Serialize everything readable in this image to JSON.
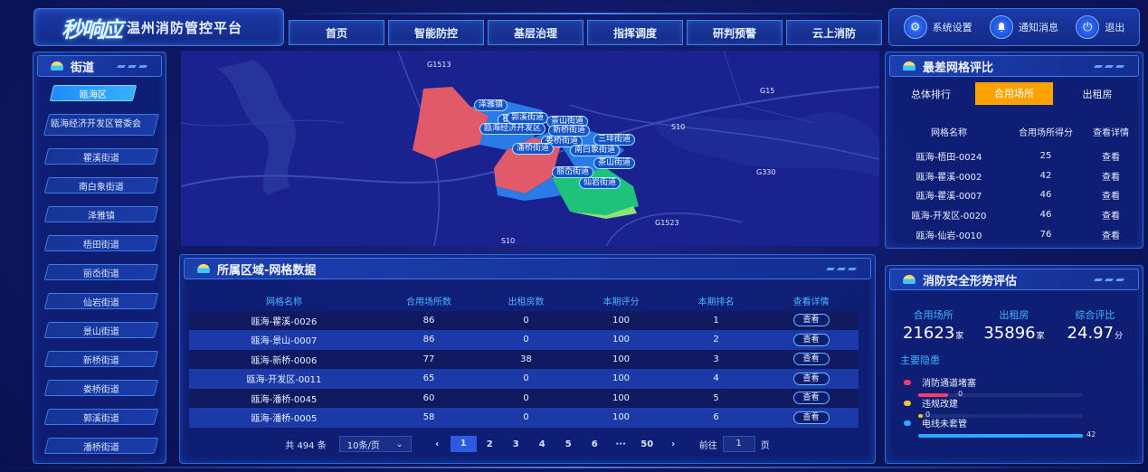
{
  "header": {
    "logo_mark": "秒响应",
    "title": "温州消防管控平台",
    "nav": [
      "首页",
      "智能防控",
      "基层治理",
      "指挥调度",
      "研判预警",
      "云上消防"
    ],
    "system": [
      {
        "label": "系统设置",
        "icon": "gear-icon"
      },
      {
        "label": "通知消息",
        "icon": "bell-icon"
      },
      {
        "label": "退出",
        "icon": "power-icon"
      }
    ]
  },
  "streets": {
    "title": "街道",
    "items": [
      "瓯海区",
      "瓯海经济开发区管委会",
      "瞿溪街道",
      "南白象街道",
      "泽雅镇",
      "梧田街道",
      "丽岙街道",
      "仙岩街道",
      "景山街道",
      "新桥街道",
      "娄桥街道",
      "郭溪街道",
      "潘桥街道"
    ],
    "active_index": 0
  },
  "map": {
    "road_labels": [
      "G1513",
      "G15",
      "S10",
      "G330",
      "G1523",
      "S10"
    ],
    "pins": [
      "泽雅镇",
      "瞿溪街道",
      "郭溪街道",
      "景山街道",
      "瓯海经济开发区",
      "新桥街道",
      "娄桥街道",
      "三垟街道",
      "潘桥街道",
      "南白象街道",
      "茶山街道",
      "丽岙街道",
      "仙岩街道"
    ]
  },
  "grid_data": {
    "title": "所属区域-网格数据",
    "columns": [
      "网格名称",
      "合用场所数",
      "出租房数",
      "本期评分",
      "本期排名",
      "查看详情"
    ],
    "rows": [
      [
        "瓯海-瞿溪-0026",
        "86",
        "0",
        "100",
        "1",
        "查看"
      ],
      [
        "瓯海-景山-0007",
        "86",
        "0",
        "100",
        "2",
        "查看"
      ],
      [
        "瓯海-新桥-0006",
        "77",
        "38",
        "100",
        "3",
        "查看"
      ],
      [
        "瓯海-开发区-0011",
        "65",
        "0",
        "100",
        "4",
        "查看"
      ],
      [
        "瓯海-潘桥-0045",
        "60",
        "0",
        "100",
        "5",
        "查看"
      ],
      [
        "瓯海-潘桥-0005",
        "58",
        "0",
        "100",
        "6",
        "查看"
      ]
    ],
    "pager": {
      "total": "共 494 条",
      "page_size": "10条/页",
      "prev": "‹",
      "pages": [
        "1",
        "2",
        "3",
        "4",
        "5",
        "6",
        "···",
        "50"
      ],
      "next": "›",
      "goto_label": "前往",
      "goto_value": "1",
      "page_unit": "页",
      "current": "1"
    }
  },
  "worst_rank": {
    "title": "最差网格评比",
    "tabs": [
      "总体排行",
      "合用场所",
      "出租房"
    ],
    "active_tab": 1,
    "columns": [
      "网格名称",
      "合用场所得分",
      "查看详情"
    ],
    "rows": [
      [
        "瓯海-梧田-0024",
        "25",
        "查看"
      ],
      [
        "瓯海-瞿溪-0002",
        "42",
        "查看"
      ],
      [
        "瓯海-瞿溪-0007",
        "46",
        "查看"
      ],
      [
        "瓯海-开发区-0020",
        "46",
        "查看"
      ],
      [
        "瓯海-仙岩-0010",
        "76",
        "查看"
      ]
    ]
  },
  "safety": {
    "title": "消防安全形势评估",
    "stats": [
      {
        "label": "合用场所",
        "value": "21623",
        "unit": "家"
      },
      {
        "label": "出租房",
        "value": "35896",
        "unit": "家"
      },
      {
        "label": "综合评比",
        "value": "24.97",
        "unit": "分"
      }
    ],
    "hazard_title": "主要隐患",
    "hazards": [
      {
        "name": "消防通道堵塞",
        "value": "0",
        "color": "#ff3b6b",
        "fraction": 0.18
      },
      {
        "name": "违规改建",
        "value": "0",
        "color": "#f4c430",
        "fraction": 0.03
      },
      {
        "name": "电线未套管",
        "value": "42",
        "color": "#2ea8ff",
        "fraction": 1.0
      }
    ]
  }
}
